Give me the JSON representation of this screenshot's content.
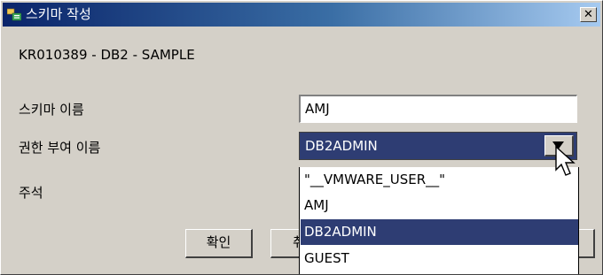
{
  "window": {
    "title": "스키마 작성",
    "close_glyph": "✕",
    "subtitle": "KR010389 - DB2 - SAMPLE"
  },
  "form": {
    "schema_name_label": "스키마 이름",
    "schema_name_value": "AMJ",
    "authorization_label": "권한 부여 이름",
    "authorization_selected": "DB2ADMIN",
    "comment_label": "주석"
  },
  "dropdown": {
    "options": [
      "\"__VMWARE_USER__\"",
      "AMJ",
      "DB2ADMIN",
      "GUEST"
    ],
    "selected_index": 2
  },
  "buttons": {
    "ok_label": "확인",
    "cancel_label_partial": "취"
  },
  "colors": {
    "selection": "#2e3d73",
    "titlebar_start": "#0a246a",
    "titlebar_end": "#a6caf0",
    "dialog_bg": "#d4d0c8"
  }
}
